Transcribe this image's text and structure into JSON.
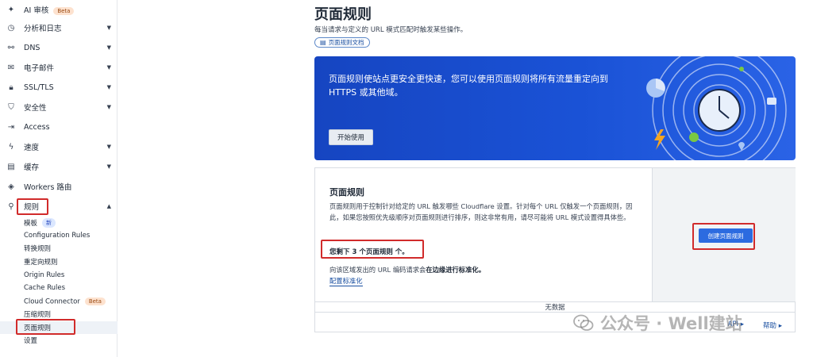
{
  "sidebar": {
    "items": [
      {
        "label": "AI 审核",
        "badge": "Beta",
        "icon": "sparkle-icon",
        "chevron": false
      },
      {
        "label": "分析和日志",
        "icon": "chart-clock-icon",
        "chevron": true
      },
      {
        "label": "DNS",
        "icon": "network-icon",
        "chevron": true
      },
      {
        "label": "电子邮件",
        "icon": "mail-icon",
        "chevron": true
      },
      {
        "label": "SSL/TLS",
        "icon": "lock-icon",
        "chevron": true
      },
      {
        "label": "安全性",
        "icon": "shield-icon",
        "chevron": true
      },
      {
        "label": "Access",
        "icon": "login-icon",
        "chevron": false
      },
      {
        "label": "速度",
        "icon": "lightning-icon",
        "chevron": true
      },
      {
        "label": "缓存",
        "icon": "drive-icon",
        "chevron": true
      },
      {
        "label": "Workers 路由",
        "icon": "workers-icon",
        "chevron": false
      },
      {
        "label": "规则",
        "icon": "rules-icon",
        "chevron": true
      }
    ],
    "sub_items": [
      {
        "label": "模板",
        "badge": "新"
      },
      {
        "label": "Configuration Rules"
      },
      {
        "label": "转换规则"
      },
      {
        "label": "重定向规则"
      },
      {
        "label": "Origin Rules"
      },
      {
        "label": "Cache Rules"
      },
      {
        "label": "Cloud Connector",
        "badge": "Beta"
      },
      {
        "label": "压缩规则"
      },
      {
        "label": "页面规则",
        "active": true
      },
      {
        "label": "设置"
      }
    ]
  },
  "page": {
    "title": "页面规则",
    "subtitle": "每当请求与定义的 URL 模式匹配时触发某些操作。",
    "doc_link": "页面规则文档"
  },
  "hero": {
    "text": "页面规则使站点更安全更快速，您可以使用页面规则将所有流量重定向到 HTTPS 或其他域。",
    "button": "开始使用"
  },
  "card": {
    "title": "页面规则",
    "description": "页面规则用于控制针对给定的 URL 触发哪些 Cloudflare 设置。针对每个 URL 仅触发一个页面规则，因此，如果您按照优先级顺序对页面规则进行排序，则这非常有用，请尽可能将 URL 模式设置得具体些。",
    "remaining": "您剩下 3 个页面规则 个。",
    "note_prefix": "向该区域发出的 URL 编码请求会",
    "note_bold": "在边缘进行标准化。",
    "config_link": "配置标准化",
    "create_button": "创建页面规则",
    "no_data": "无数据",
    "api_link": "API ▸",
    "help_link": "帮助 ▸"
  },
  "watermark": {
    "text": "公众号 · Well建站"
  },
  "colors": {
    "accent_blue": "#2c6be0",
    "hero_blue": "#1a52d6",
    "highlight_red": "#d12b2b"
  }
}
